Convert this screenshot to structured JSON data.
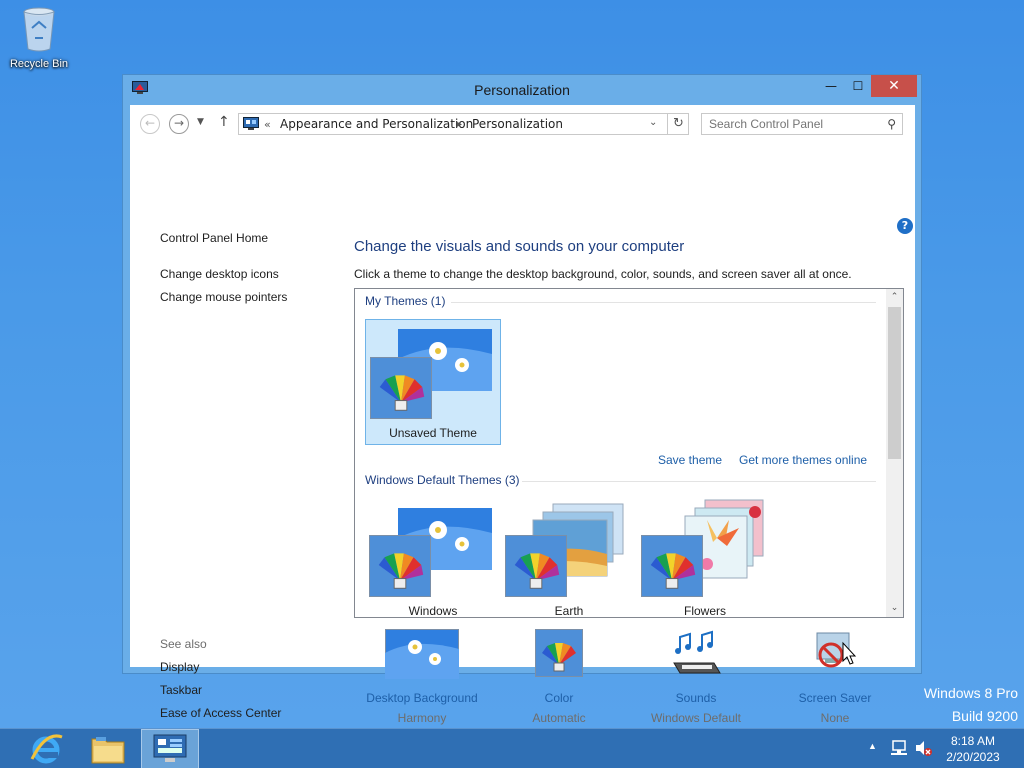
{
  "desktop": {
    "recycle_bin_label": "Recycle Bin"
  },
  "window": {
    "title": "Personalization",
    "minimize": "—",
    "maximize": "☐",
    "close": "✕"
  },
  "address": {
    "chevron": "«",
    "crumb1": "Appearance and Personalization",
    "separator": "▸",
    "crumb2": "Personalization"
  },
  "search": {
    "placeholder": "Search Control Panel"
  },
  "left": {
    "home": "Control Panel Home",
    "desktop_icons": "Change desktop icons",
    "mouse_pointers": "Change mouse pointers",
    "see_also": "See also",
    "display": "Display",
    "taskbar": "Taskbar",
    "ease_of_access": "Ease of Access Center"
  },
  "main": {
    "heading": "Change the visuals and sounds on your computer",
    "subheading": "Click a theme to change the desktop background, color, sounds, and screen saver all at once.",
    "my_themes_header": "My Themes (1)",
    "default_themes_header": "Windows Default Themes (3)",
    "save_theme": "Save theme",
    "get_more": "Get more themes online",
    "themes": {
      "unsaved": "Unsaved Theme",
      "windows": "Windows",
      "earth": "Earth",
      "flowers": "Flowers"
    }
  },
  "bottom": {
    "background": {
      "label": "Desktop Background",
      "value": "Harmony"
    },
    "color": {
      "label": "Color",
      "value": "Automatic"
    },
    "sounds": {
      "label": "Sounds",
      "value": "Windows Default"
    },
    "screensaver": {
      "label": "Screen Saver",
      "value": "None"
    }
  },
  "watermark": {
    "line1": "Windows 8 Pro",
    "line2": "Build 9200"
  },
  "taskbar": {
    "time": "8:18 AM",
    "date": "2/20/2023"
  },
  "colors": {
    "accent_link": "#1e5fa8",
    "heading": "#1e3f80",
    "close_button": "#c7504a",
    "selection": "#cde8fb"
  }
}
